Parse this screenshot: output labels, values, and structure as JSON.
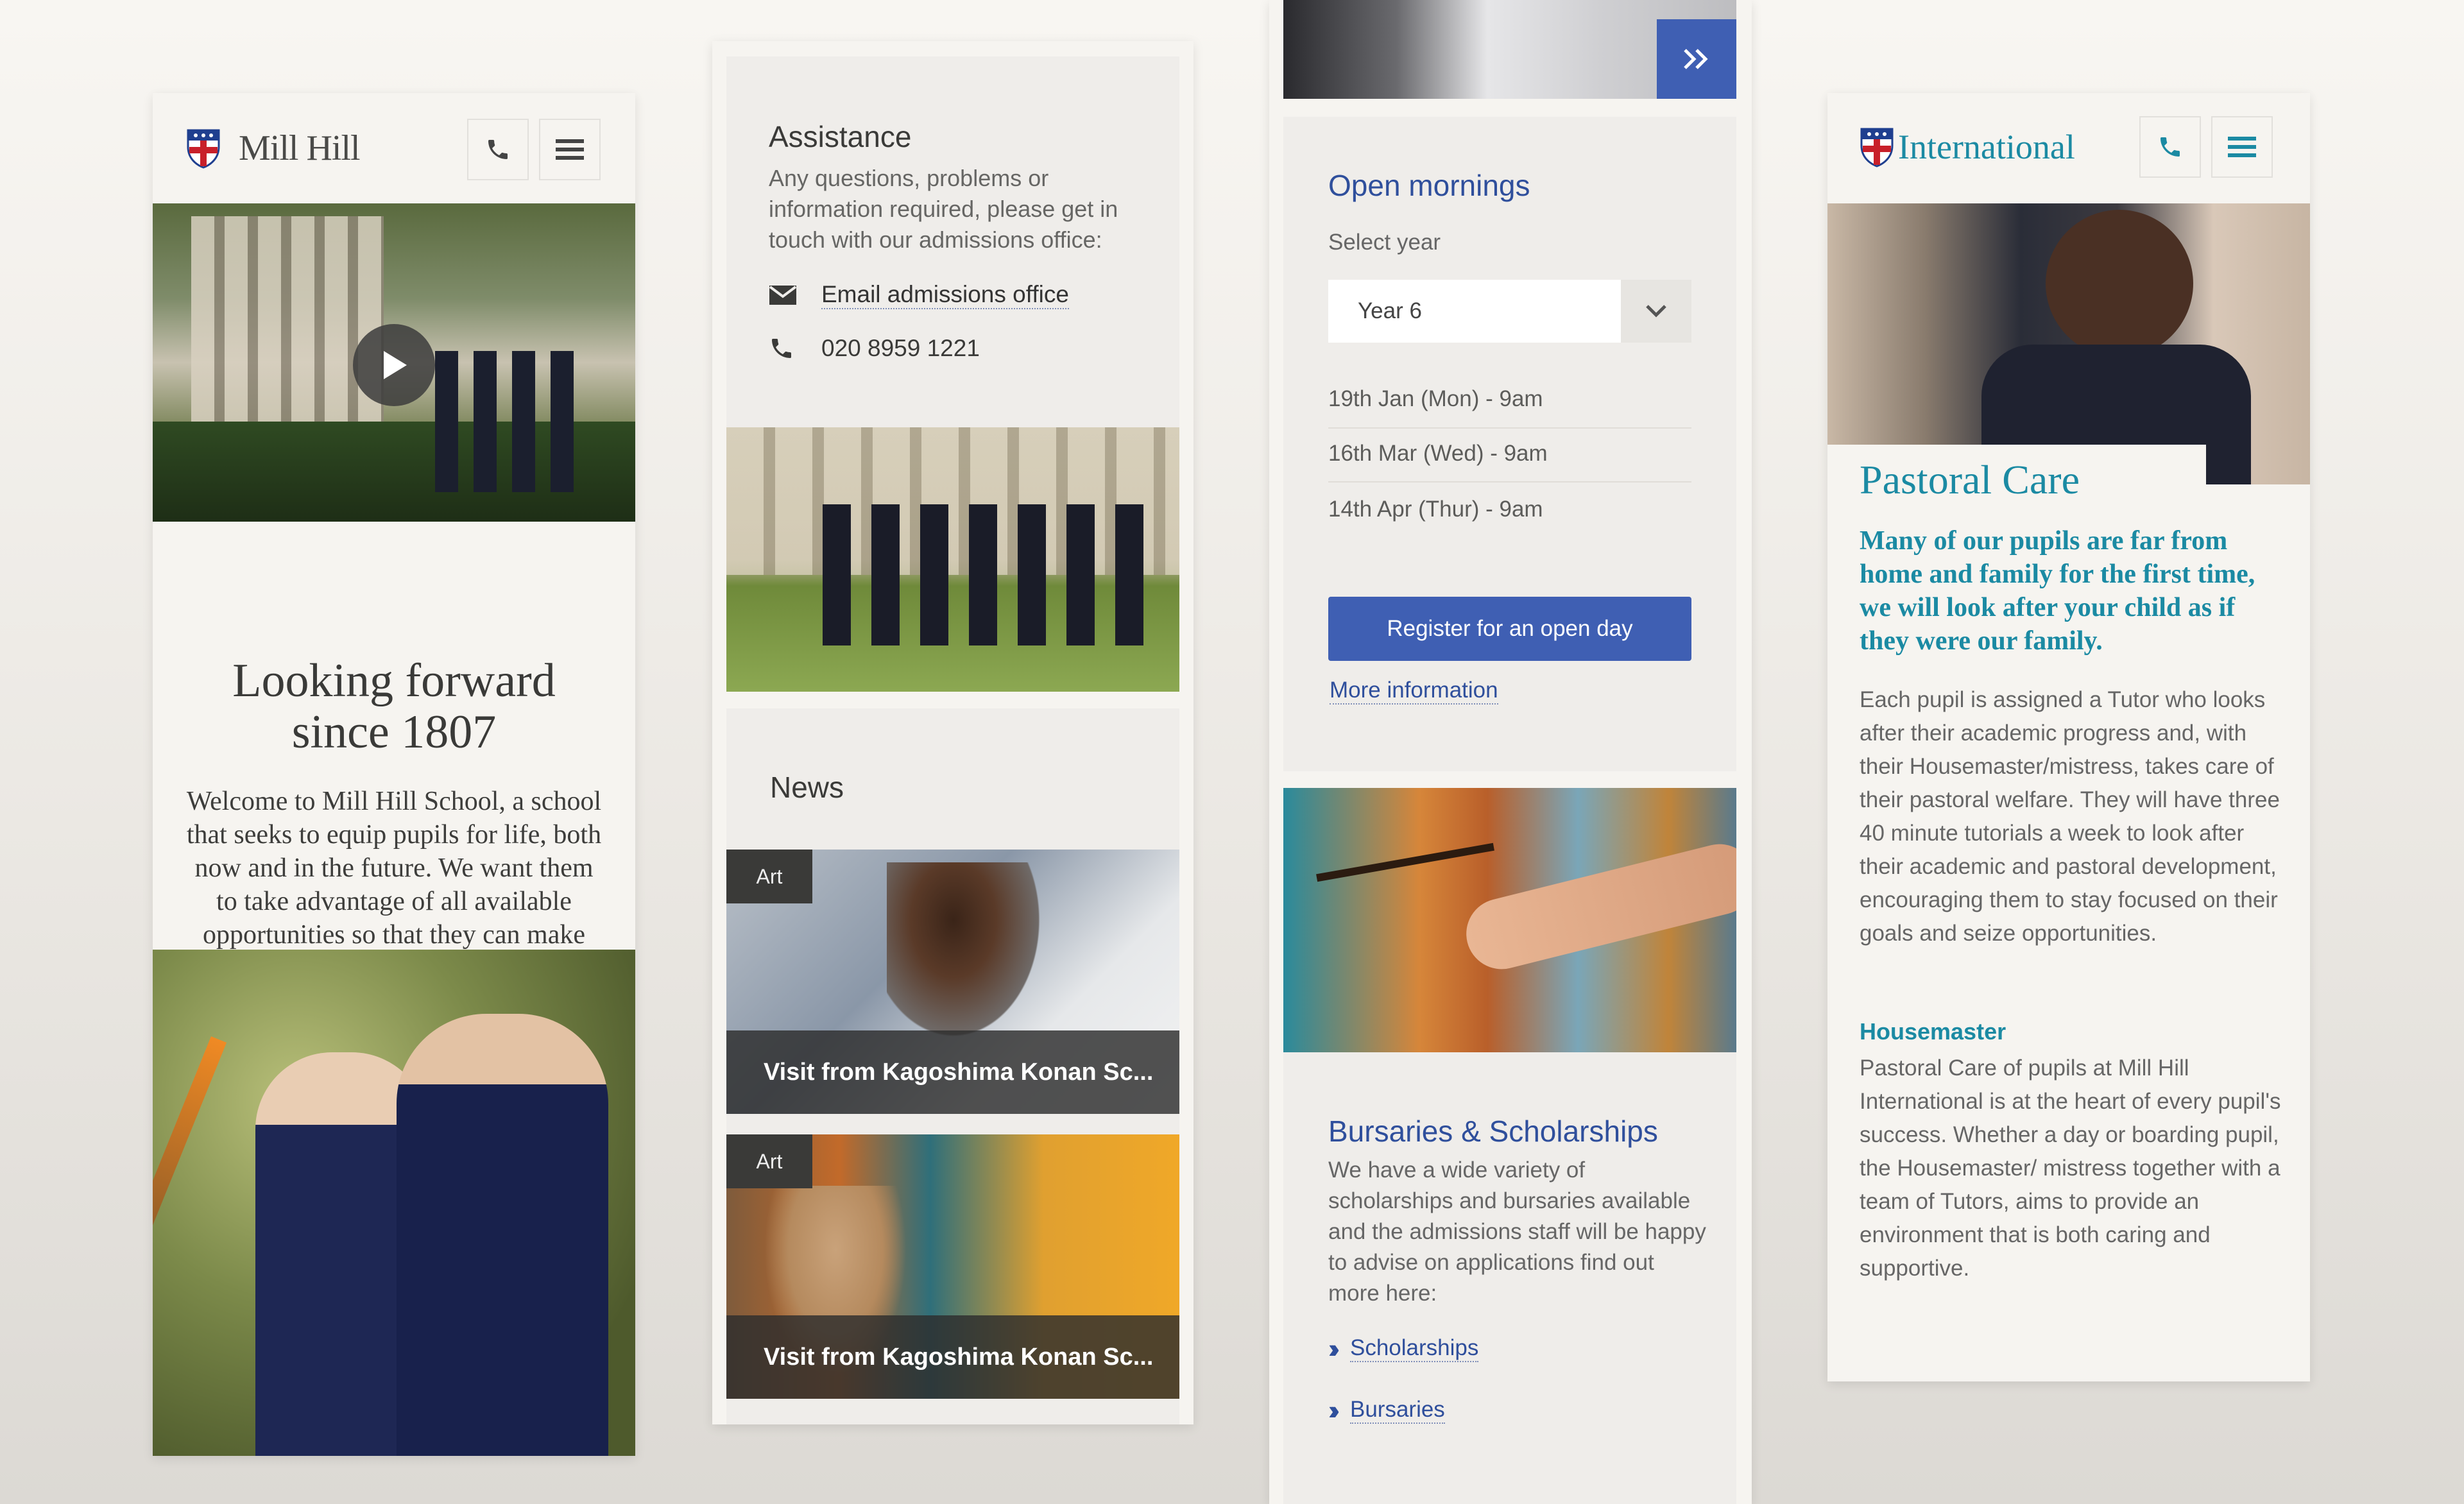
{
  "screen1": {
    "logo_text": "Mill Hill",
    "heading_line1": "Looking forward",
    "heading_line2": "since 1807",
    "intro": "Welcome to Mill Hill School, a school that seeks to equip pupils for life, both now and in the future. We want them to take advantage of all available opportunities so that they can make the most out of life."
  },
  "screen2": {
    "assistance_title": "Assistance",
    "assistance_text": "Any questions, problems or information required, please get in touch with our admissions office:",
    "email_label": "Email admissions office",
    "phone": "020 8959 1221",
    "news_title": "News",
    "news": [
      {
        "tag": "Art",
        "title": "Visit from Kagoshima Konan Sc..."
      },
      {
        "tag": "Art",
        "title": "Visit from Kagoshima Konan Sc..."
      }
    ]
  },
  "screen3": {
    "open_mornings_title": "Open mornings",
    "select_label": "Select year",
    "select_value": "Year 6",
    "dates": [
      "19th Jan (Mon) - 9am",
      "16th Mar (Wed) - 9am",
      "14th Apr (Thur) - 9am"
    ],
    "register_label": "Register for an open day",
    "more_info": "More information",
    "bursaries_title": "Bursaries & Scholarships",
    "bursaries_text": "We have a wide variety of scholarships and bursaries available and the admissions staff will be happy to advise on applications find out more here:",
    "links": [
      "Scholarships",
      "Bursaries"
    ]
  },
  "screen4": {
    "logo_text": "International",
    "title": "Pastoral Care",
    "lead": "Many of our pupils are far from home and family for the first time, we will look after your child as if they were our family.",
    "body": "Each pupil is assigned a Tutor who looks after their academic progress and, with their Housemaster/mistress, takes care of their pastoral welfare. They will have three 40 minute tutorials a week to look after their academic and pastoral development, encouraging them to stay focused on their goals and seize opportunities.",
    "sub_heading": "Housemaster",
    "sub_body": "Pastoral Care of pupils at Mill Hill International is at the heart of every pupil's success. Whether a day or boarding pupil, the Housemaster/ mistress together with a team of Tutors, aims to provide an environment that is both caring and supportive."
  },
  "colors": {
    "brand_blue": "#3f5fb3",
    "heading_blue": "#2f4f9c",
    "teal": "#1b8aa3",
    "card_bg": "#f6f4f0",
    "panel_bg": "#efedea"
  },
  "icons": [
    "crest-icon",
    "phone-icon",
    "menu-icon",
    "play-icon",
    "email-icon",
    "chevron-down-icon",
    "double-chevron-right-icon"
  ]
}
